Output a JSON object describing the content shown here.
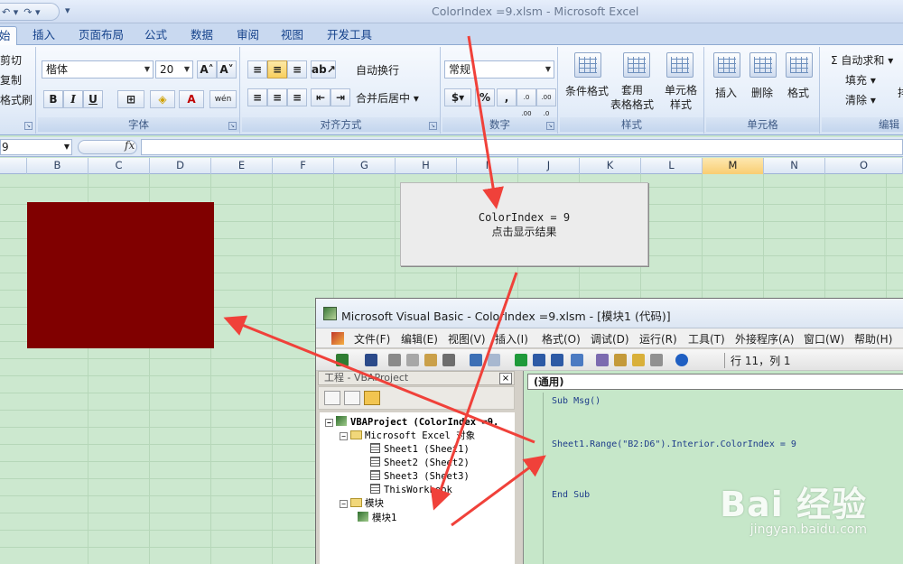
{
  "window": {
    "title": "ColorIndex =9.xlsm - Microsoft Excel"
  },
  "qat": {
    "undo": "↶ ▾",
    "redo": "↷ ▾",
    "more": "▾"
  },
  "ribbon_tabs": [
    "始",
    "插入",
    "页面布局",
    "公式",
    "数据",
    "审阅",
    "视图",
    "开发工具"
  ],
  "clipboard": {
    "cut": "剪切",
    "copy": "复制",
    "painter": "格式刷"
  },
  "font": {
    "name": "楷体",
    "size": "20",
    "grow": "A˄",
    "shrink": "A˅",
    "bold": "B",
    "italic": "I",
    "underline": "U",
    "wen": "wén",
    "group_label": "字体"
  },
  "alignment": {
    "wrap": "自动换行",
    "merge": "合并后居中 ▾",
    "group_label": "对齐方式"
  },
  "number": {
    "format": "常规",
    "percent": "%",
    "comma": ",",
    "inc": ".0 .00",
    "dec": ".00 .0",
    "group_label": "数字"
  },
  "styles": {
    "conditional": "条件格式",
    "table": "套用\n表格格式",
    "cell": "单元格\n样式",
    "group_label": "样式"
  },
  "cells": {
    "insert": "插入",
    "delete": "删除",
    "format": "格式",
    "group_label": "单元格"
  },
  "editing": {
    "autosum": "Σ 自动求和 ▾",
    "fill": "填充 ▾",
    "clear": "清除 ▾",
    "sort": "排",
    "group_label": "编辑"
  },
  "formula_bar": {
    "namebox": "9",
    "fx": "fx"
  },
  "columns": [
    "B",
    "C",
    "D",
    "E",
    "F",
    "G",
    "H",
    "I",
    "J",
    "K",
    "L",
    "M",
    "N",
    "O"
  ],
  "selected_column": "M",
  "colors": {
    "fill": "#800000",
    "grid_bg": "#cce8cf",
    "arrow": "#f0413a"
  },
  "macro_button": {
    "line1": "ColorIndex = 9",
    "line2": "点击显示结果"
  },
  "vba": {
    "title": "Microsoft Visual Basic - ColorIndex =9.xlsm - [模块1 (代码)]",
    "menu": [
      "文件(F)",
      "编辑(E)",
      "视图(V)",
      "插入(I)",
      "格式(O)",
      "调试(D)",
      "运行(R)",
      "工具(T)",
      "外接程序(A)",
      "窗口(W)",
      "帮助(H)"
    ],
    "cursor": "行 11，列 1",
    "project_title": "工程 - VBAProject",
    "close": "×",
    "tree": {
      "root": "VBAProject (ColorIndex =9.",
      "objects_folder": "Microsoft Excel 对象",
      "sheet1": "Sheet1 (Sheet1)",
      "sheet2": "Sheet2 (Sheet2)",
      "sheet3": "Sheet3 (Sheet3)",
      "workbook": "ThisWorkbook",
      "modules_folder": "模块",
      "module1": "模块1"
    },
    "code_selector": "(通用)",
    "code": [
      "Sub Msg()",
      "Sheet1.Range(\"B2:D6\").Interior.ColorIndex = 9",
      "End Sub"
    ]
  },
  "watermark": {
    "logo": "Bai 经验",
    "url": "jingyan.baidu.com"
  }
}
